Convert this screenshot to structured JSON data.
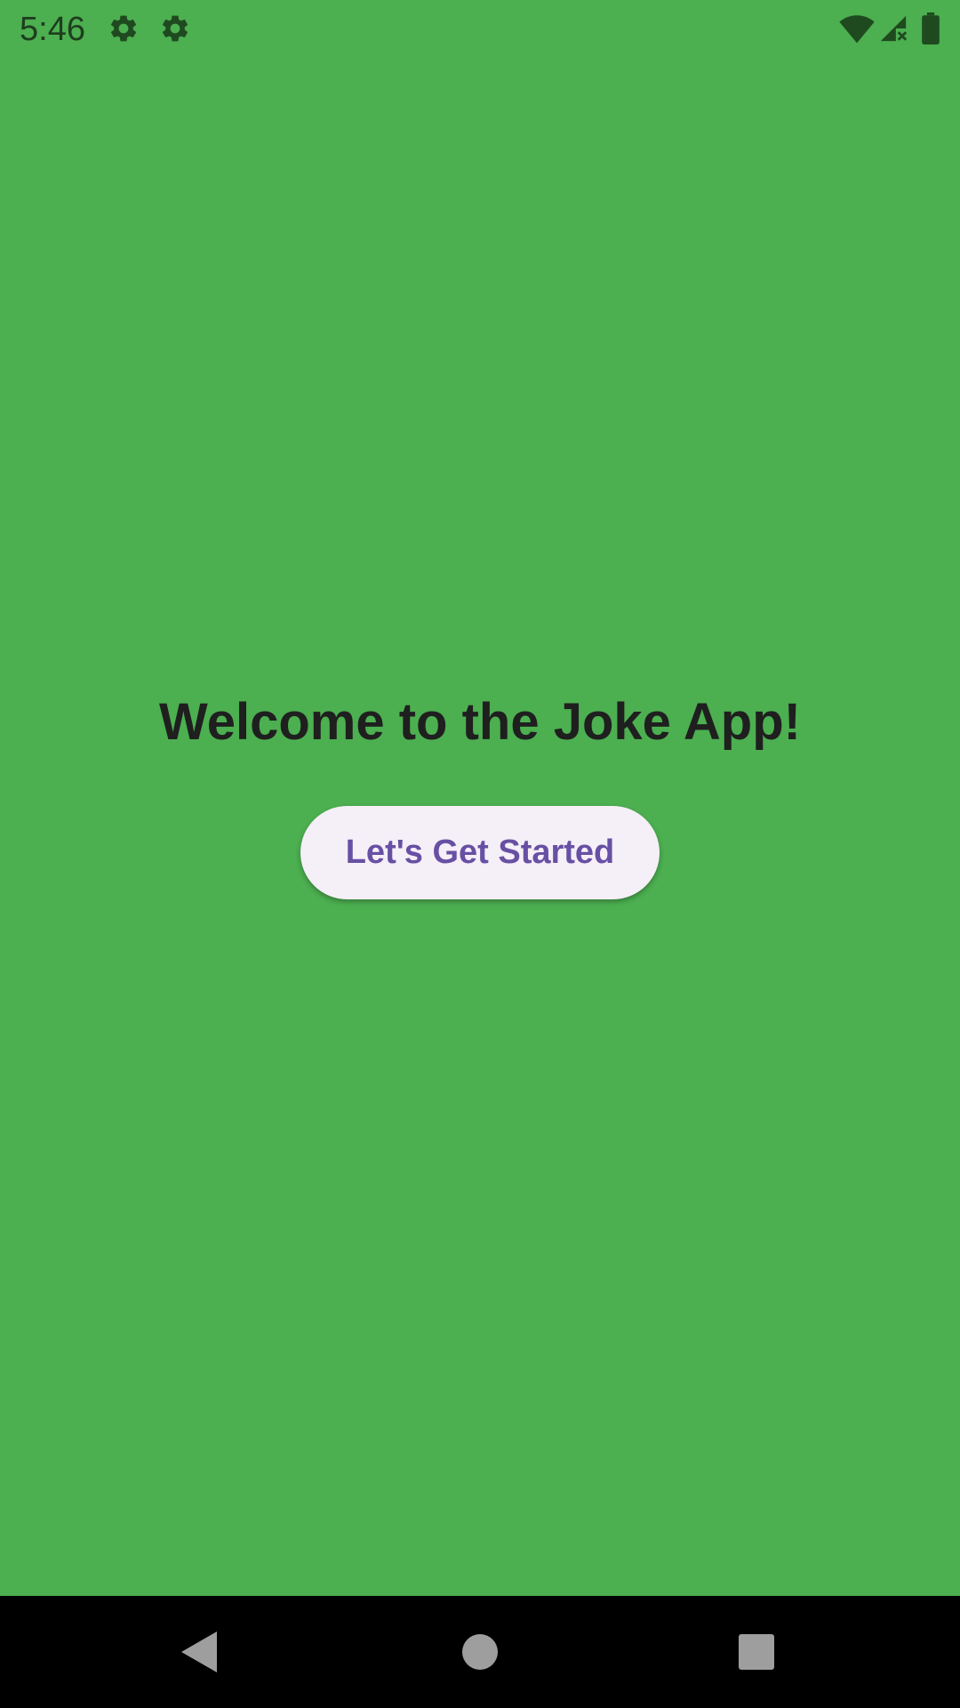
{
  "status_bar": {
    "time": "5:46",
    "icons": [
      "settings-gear-icon",
      "settings-gear-icon",
      "wifi-icon",
      "cell-signal-no-data-icon",
      "battery-icon"
    ]
  },
  "main": {
    "title": "Welcome to the Joke App!",
    "start_button_label": "Let's Get Started"
  },
  "nav_bar": {
    "buttons": [
      "back-icon",
      "home-icon",
      "recents-icon"
    ]
  },
  "colors": {
    "background": "#4CAF50",
    "button_bg": "#F5EFF7",
    "button_text": "#6750A4",
    "title_text": "#1F1F1F",
    "nav_bar": "#000000",
    "status_icons": "#1F3D1F"
  }
}
